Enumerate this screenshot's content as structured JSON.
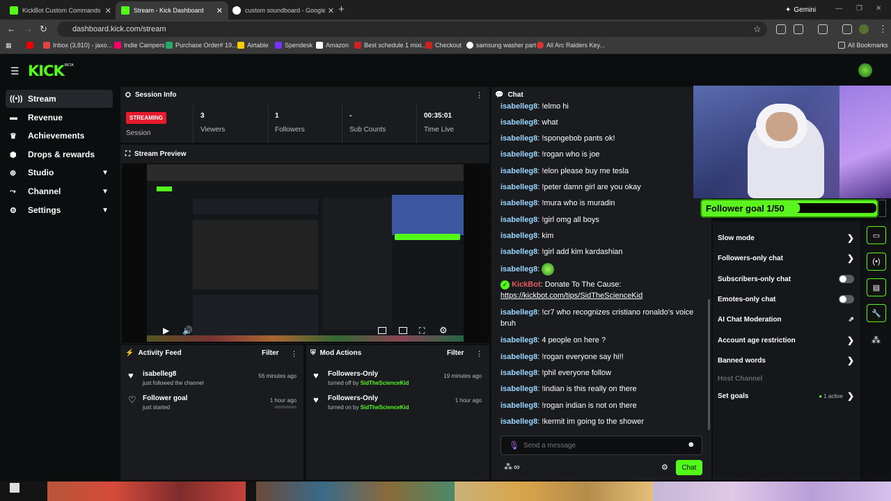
{
  "browser": {
    "tabs": [
      {
        "title": "KickBot Custom Commands",
        "active": false
      },
      {
        "title": "Stream - Kick Dashboard",
        "active": true
      },
      {
        "title": "custom soundboard - Google S",
        "active": false
      }
    ],
    "gemini_label": "Gemini",
    "url": "dashboard.kick.com/stream",
    "bookmarks": [
      "Inbox (3,810) - jaxo...",
      "Indie Campers",
      "Purchase Order# 19...",
      "Airtable",
      "Spendesk",
      "Amazon",
      "Best schedule 1 mixi...",
      "Checkout",
      "samsung washer part",
      "All Arc Raiders Key..."
    ],
    "all_bookmarks": "All Bookmarks"
  },
  "brand": {
    "logo": "KICK",
    "beta": "BETA",
    "accent": "#53fc18"
  },
  "sidebar": {
    "items": [
      {
        "label": "Stream",
        "icon": "broadcast-icon"
      },
      {
        "label": "Revenue",
        "icon": "money-icon"
      },
      {
        "label": "Achievements",
        "icon": "trophy-icon"
      },
      {
        "label": "Drops & rewards",
        "icon": "gift-icon"
      },
      {
        "label": "Studio",
        "icon": "studio-icon"
      },
      {
        "label": "Channel",
        "icon": "channel-icon"
      },
      {
        "label": "Settings",
        "icon": "gear-icon"
      }
    ]
  },
  "session": {
    "title": "Session Info",
    "status": "STREAMING",
    "status_label": "Session",
    "stats": [
      {
        "value": "3",
        "label": "Viewers"
      },
      {
        "value": "1",
        "label": "Followers"
      },
      {
        "value": "-",
        "label": "Sub Counts"
      },
      {
        "value": "00:35:01",
        "label": "Time Live"
      }
    ]
  },
  "preview": {
    "title": "Stream Preview"
  },
  "activity": {
    "title": "Activity Feed",
    "filter": "Filter",
    "items": [
      {
        "title": "isabelleg8",
        "sub": "just followed the channel",
        "time": "56 minutes ago"
      },
      {
        "title": "Follower goal",
        "sub": "just started",
        "time": "1 hour ago"
      }
    ]
  },
  "mod": {
    "title": "Mod Actions",
    "filter": "Filter",
    "items": [
      {
        "title": "Followers-Only",
        "sub": "turned off by",
        "by": "SidTheScienceKid",
        "time": "19 minutes ago"
      },
      {
        "title": "Followers-Only",
        "sub": "turned on by",
        "by": "SidTheScienceKid",
        "time": "1 hour ago"
      }
    ]
  },
  "chat": {
    "title": "Chat",
    "messages": [
      {
        "user": "isabelleg8",
        "text": "!elmo hi"
      },
      {
        "user": "isabelleg8",
        "text": "what"
      },
      {
        "user": "isabelleg8",
        "text": "!spongebob pants ok!"
      },
      {
        "user": "isabelleg8",
        "text": "!rogan who is joe"
      },
      {
        "user": "isabelleg8",
        "text": "!elon please buy me tesla"
      },
      {
        "user": "isabelleg8",
        "text": "!peter damn girl are you okay"
      },
      {
        "user": "isabelleg8",
        "text": "!mura who is muradin"
      },
      {
        "user": "isabelleg8",
        "text": "!girl omg all boys"
      },
      {
        "user": "isabelleg8",
        "text": "kim"
      },
      {
        "user": "isabelleg8",
        "text": "!girl add kim kardashian"
      },
      {
        "user": "isabelleg8",
        "text": ""
      }
    ],
    "bot": {
      "user": "KickBot",
      "text": "Donate To The Cause:",
      "link": "https://kickbot.com/tips/SidTheScienceKid"
    },
    "messages2": [
      {
        "user": "isabelleg8",
        "text": "!cr7 who recognizes cristiano ronaldo's voice bruh"
      },
      {
        "user": "isabelleg8",
        "text": "4 people on here ?"
      },
      {
        "user": "isabelleg8",
        "text": "!rogan everyone say hi!!"
      },
      {
        "user": "isabelleg8",
        "text": "!phil everyone follow"
      },
      {
        "user": "isabelleg8",
        "text": "!indian is this really on there"
      },
      {
        "user": "isabelleg8",
        "text": "!rogan indian is not on there"
      },
      {
        "user": "isabelleg8",
        "text": "!kermit im going to the shower"
      }
    ],
    "input_placeholder": "Send a message",
    "send_label": "Chat"
  },
  "goal": {
    "label": "Follower goal 1/50",
    "progress": 0.02
  },
  "settings": {
    "rows": [
      {
        "label": "Slow mode",
        "kind": "chevron"
      },
      {
        "label": "Followers-only chat",
        "kind": "chevron"
      },
      {
        "label": "Subscribers-only chat",
        "kind": "toggle"
      },
      {
        "label": "Emotes-only chat",
        "kind": "toggle"
      },
      {
        "label": "AI Chat Moderation",
        "kind": "external"
      },
      {
        "label": "Account age restriction",
        "kind": "chevron"
      },
      {
        "label": "Banned words",
        "kind": "chevron"
      },
      {
        "label": "Host Channel",
        "kind": "disabled"
      },
      {
        "label": "Set goals",
        "kind": "chevron",
        "badge": "1 active"
      }
    ]
  }
}
